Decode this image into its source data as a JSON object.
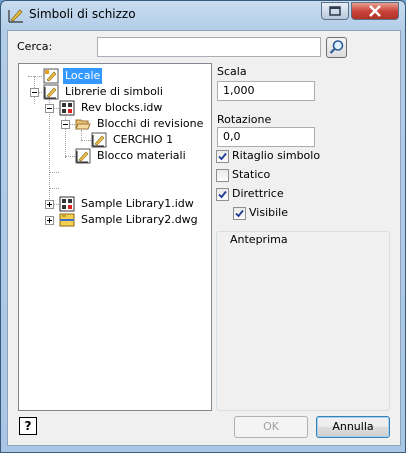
{
  "window": {
    "title": "Simboli di schizzo"
  },
  "search": {
    "label": "Cerca:",
    "value": ""
  },
  "tree": {
    "items": [
      {
        "label": "Locale",
        "selected": true
      },
      {
        "label": "Librerie di simboli"
      },
      {
        "label": "Rev blocks.idw"
      },
      {
        "label": "Blocchi di revisione"
      },
      {
        "label": "CERCHIO 1"
      },
      {
        "label": "Blocco materiali"
      },
      {
        "label": "Sample Library1.idw"
      },
      {
        "label": "Sample Library2.dwg"
      }
    ]
  },
  "scale": {
    "label": "Scala",
    "value": "1,000"
  },
  "rotation": {
    "label": "Rotazione",
    "value": "0,0"
  },
  "options": {
    "clip": {
      "label": "Ritaglio simbolo",
      "checked": true
    },
    "static": {
      "label": "Statico",
      "checked": false
    },
    "leader": {
      "label": "Direttrice",
      "checked": true
    },
    "visible": {
      "label": "Visibile",
      "checked": true
    }
  },
  "preview": {
    "label": "Anteprima"
  },
  "buttons": {
    "help": "?",
    "ok": "OK",
    "cancel": "Annulla"
  },
  "colors": {
    "selection": "#3399ff",
    "titlebar": "#b3cde8",
    "close": "#c9443a"
  }
}
